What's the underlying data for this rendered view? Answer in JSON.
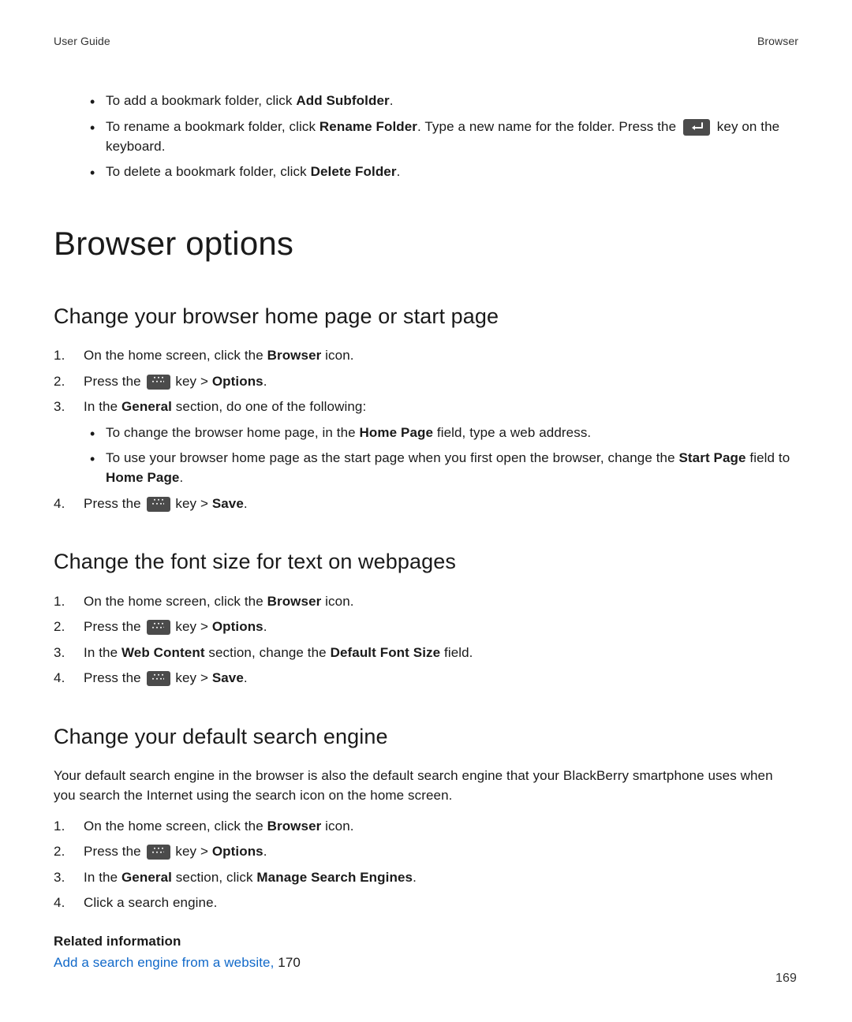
{
  "header": {
    "left": "User Guide",
    "right": "Browser"
  },
  "intro_bullets": [
    {
      "parts": [
        {
          "t": "To add a bookmark folder, click "
        },
        {
          "t": "Add Subfolder",
          "b": true
        },
        {
          "t": "."
        }
      ]
    },
    {
      "parts": [
        {
          "t": "To rename a bookmark folder, click "
        },
        {
          "t": "Rename Folder",
          "b": true
        },
        {
          "t": ". Type a new name for the folder. Press the "
        },
        {
          "icon": "enter"
        },
        {
          "t": " key on the keyboard."
        }
      ]
    },
    {
      "parts": [
        {
          "t": "To delete a bookmark folder, click "
        },
        {
          "t": "Delete Folder",
          "b": true
        },
        {
          "t": "."
        }
      ]
    }
  ],
  "h1": "Browser options",
  "sections": [
    {
      "title": "Change your browser home page or start page",
      "steps": [
        {
          "parts": [
            {
              "t": "On the home screen, click the "
            },
            {
              "t": "Browser",
              "b": true
            },
            {
              "t": " icon."
            }
          ]
        },
        {
          "parts": [
            {
              "t": "Press the "
            },
            {
              "icon": "bb"
            },
            {
              "t": " key > "
            },
            {
              "t": "Options",
              "b": true
            },
            {
              "t": "."
            }
          ]
        },
        {
          "parts": [
            {
              "t": "In the "
            },
            {
              "t": "General",
              "b": true
            },
            {
              "t": " section, do one of the following:"
            }
          ],
          "subs": [
            {
              "parts": [
                {
                  "t": "To change the browser home page, in the "
                },
                {
                  "t": "Home Page",
                  "b": true
                },
                {
                  "t": " field, type a web address."
                }
              ]
            },
            {
              "parts": [
                {
                  "t": "To use your browser home page as the start page when you first open the browser, change the "
                },
                {
                  "t": "Start Page",
                  "b": true
                },
                {
                  "t": " field to "
                },
                {
                  "t": "Home Page",
                  "b": true
                },
                {
                  "t": "."
                }
              ]
            }
          ]
        },
        {
          "parts": [
            {
              "t": "Press the "
            },
            {
              "icon": "bb"
            },
            {
              "t": " key > "
            },
            {
              "t": "Save",
              "b": true
            },
            {
              "t": "."
            }
          ]
        }
      ]
    },
    {
      "title": "Change the font size for text on webpages",
      "steps": [
        {
          "parts": [
            {
              "t": "On the home screen, click the "
            },
            {
              "t": "Browser",
              "b": true
            },
            {
              "t": " icon."
            }
          ]
        },
        {
          "parts": [
            {
              "t": "Press the "
            },
            {
              "icon": "bb"
            },
            {
              "t": " key > "
            },
            {
              "t": "Options",
              "b": true
            },
            {
              "t": "."
            }
          ]
        },
        {
          "parts": [
            {
              "t": "In the "
            },
            {
              "t": "Web Content",
              "b": true
            },
            {
              "t": " section, change the "
            },
            {
              "t": "Default Font Size",
              "b": true
            },
            {
              "t": " field."
            }
          ]
        },
        {
          "parts": [
            {
              "t": "Press the "
            },
            {
              "icon": "bb"
            },
            {
              "t": " key > "
            },
            {
              "t": "Save",
              "b": true
            },
            {
              "t": "."
            }
          ]
        }
      ]
    },
    {
      "title": "Change your default search engine",
      "intro": "Your default search engine in the browser is also the default search engine that your BlackBerry smartphone uses when you search the Internet using the search icon on the home screen.",
      "steps": [
        {
          "parts": [
            {
              "t": "On the home screen, click the "
            },
            {
              "t": "Browser",
              "b": true
            },
            {
              "t": " icon."
            }
          ]
        },
        {
          "parts": [
            {
              "t": "Press the "
            },
            {
              "icon": "bb"
            },
            {
              "t": " key > "
            },
            {
              "t": "Options",
              "b": true
            },
            {
              "t": "."
            }
          ]
        },
        {
          "parts": [
            {
              "t": "In the "
            },
            {
              "t": "General",
              "b": true
            },
            {
              "t": " section, click "
            },
            {
              "t": "Manage Search Engines",
              "b": true
            },
            {
              "t": "."
            }
          ]
        },
        {
          "parts": [
            {
              "t": "Click a search engine."
            }
          ]
        }
      ]
    }
  ],
  "related": {
    "heading": "Related information",
    "link_text": "Add a search engine from a website,",
    "page_ref": "170"
  },
  "page_number": "169"
}
